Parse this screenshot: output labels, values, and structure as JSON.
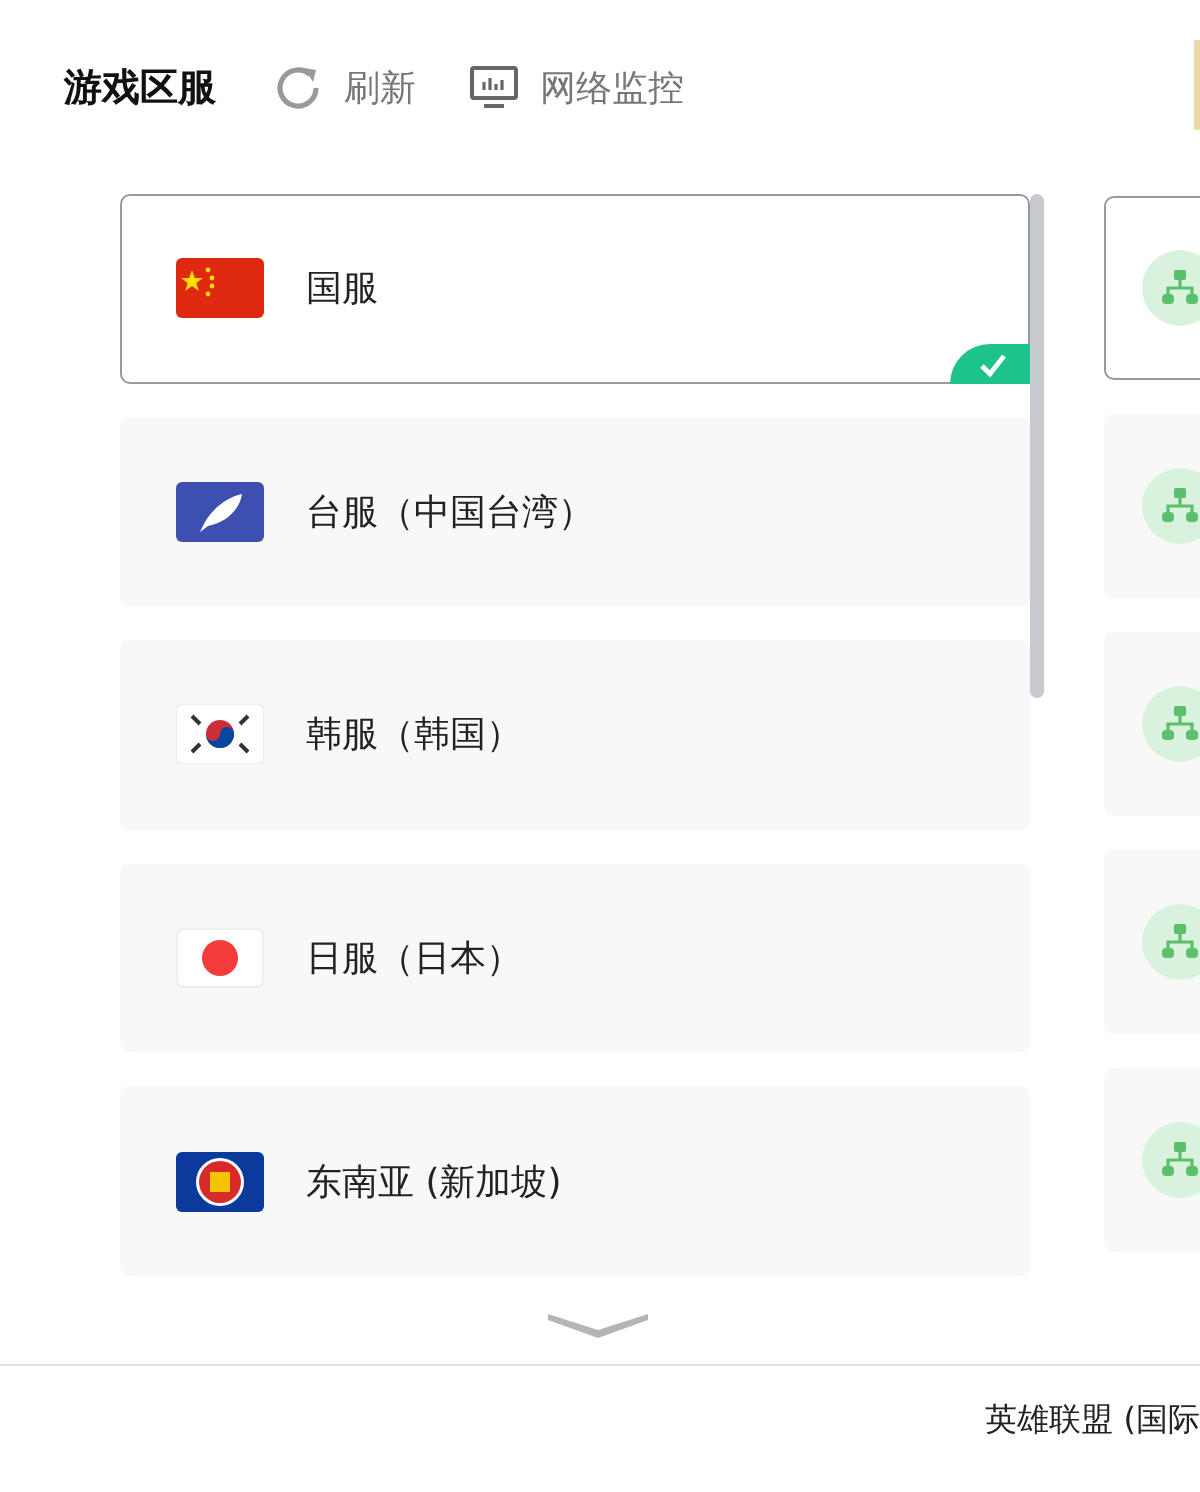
{
  "header": {
    "title": "游戏区服",
    "actions": [
      {
        "kind": "refresh",
        "label": "刷新"
      },
      {
        "kind": "monitor",
        "label": "网络监控"
      }
    ]
  },
  "regions": [
    {
      "kind": "cn",
      "label": "国服",
      "selected": true
    },
    {
      "kind": "tw",
      "label": "台服（中国台湾）",
      "selected": false
    },
    {
      "kind": "kr",
      "label": "韩服（韩国）",
      "selected": false
    },
    {
      "kind": "jp",
      "label": "日服（日本）",
      "selected": false
    },
    {
      "kind": "asean",
      "label": "东南亚 (新加坡)",
      "selected": false
    }
  ],
  "nodes": [
    {
      "selected": true
    },
    {
      "selected": false
    },
    {
      "selected": false
    },
    {
      "selected": false
    },
    {
      "selected": false
    }
  ],
  "footer": {
    "game": "英雄联盟 (国际"
  }
}
